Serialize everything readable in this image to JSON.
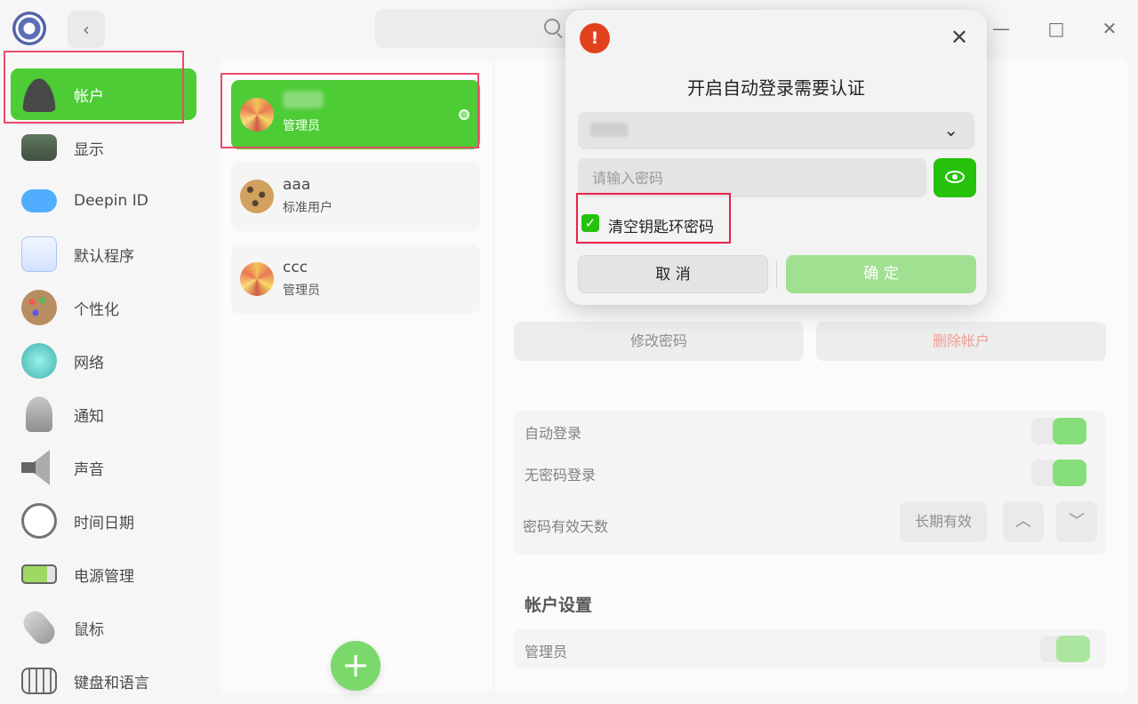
{
  "window": {
    "back_label": "‹",
    "minimize_label": "—",
    "maximize_label": "□",
    "close_label": "✕"
  },
  "sidebar": {
    "items": [
      {
        "label": "帐户",
        "icon": "account-icon",
        "color": "#222222"
      },
      {
        "label": "显示",
        "icon": "display-icon",
        "color": "#2a3a2a"
      },
      {
        "label": "Deepin ID",
        "icon": "cloud-icon",
        "color": "#2a9bff"
      },
      {
        "label": "默认程序",
        "icon": "default-apps-icon",
        "color": "#4a8fe0"
      },
      {
        "label": "个性化",
        "icon": "palette-icon",
        "color": "#8c5a30"
      },
      {
        "label": "网络",
        "icon": "network-icon",
        "color": "#2ab8b0"
      },
      {
        "label": "通知",
        "icon": "bell-icon",
        "color": "#8a8a8a"
      },
      {
        "label": "声音",
        "icon": "speaker-icon",
        "color": "#555555"
      },
      {
        "label": "时间日期",
        "icon": "clock-icon",
        "color": "#dddddd"
      },
      {
        "label": "电源管理",
        "icon": "battery-icon",
        "color": "#8ad040"
      },
      {
        "label": "鼠标",
        "icon": "mouse-icon",
        "color": "#9a9a9a"
      },
      {
        "label": "键盘和语言",
        "icon": "keyboard-icon",
        "color": "#666666"
      }
    ]
  },
  "users": [
    {
      "name": "",
      "role": "管理员",
      "avatar": "flower",
      "active": true
    },
    {
      "name": "aaa",
      "role": "标准用户",
      "avatar": "leopard",
      "active": false
    },
    {
      "name": "ccc",
      "role": "管理员",
      "avatar": "flower",
      "active": false
    }
  ],
  "add_user_label": "+",
  "detail": {
    "change_password": "修改密码",
    "delete_account": "删除帐户",
    "auto_login": "自动登录",
    "no_password_login": "无密码登录",
    "password_validity": "密码有效天数",
    "validity_value": "长期有效",
    "up_label": "︿",
    "down_label": "﹀",
    "account_settings": "帐户设置",
    "admin": "管理员"
  },
  "dialog": {
    "title": "开启自动登录需要认证",
    "password_placeholder": "请输入密码",
    "clear_keyring": "清空钥匙环密码",
    "cancel": "取 消",
    "confirm": "确 定",
    "shield_label": "!",
    "close_label": "✕",
    "chevron_label": "⌄",
    "check_label": "✓"
  },
  "colors": {
    "accent": "#26c10a",
    "highlight_box": "#e8234a"
  }
}
